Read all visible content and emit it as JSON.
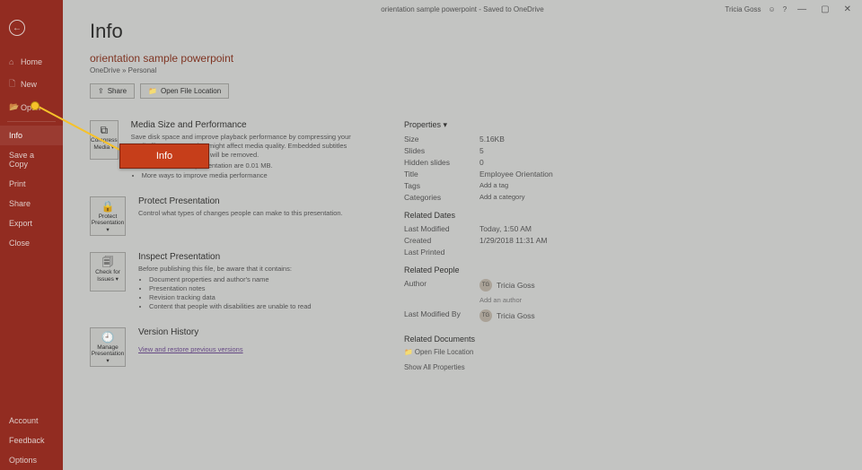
{
  "titlebar": {
    "center": "orientation sample powerpoint - Saved to OneDrive",
    "user": "Tricia Goss",
    "min": "—",
    "restore": "▢",
    "close": "✕"
  },
  "sidebar": {
    "back": "←",
    "items": [
      {
        "icon": "⌂",
        "label": "Home"
      },
      {
        "icon": "🗋",
        "label": "New"
      },
      {
        "icon": "📂",
        "label": "Open"
      },
      {
        "icon": "",
        "label": "Info"
      },
      {
        "icon": "",
        "label": "Save a Copy"
      },
      {
        "icon": "",
        "label": "Print"
      },
      {
        "icon": "",
        "label": "Share"
      },
      {
        "icon": "",
        "label": "Export"
      },
      {
        "icon": "",
        "label": "Close"
      }
    ],
    "bottom": [
      {
        "label": "Account"
      },
      {
        "label": "Feedback"
      },
      {
        "label": "Options"
      }
    ]
  },
  "page": {
    "heading": "Info",
    "doc_title": "orientation sample powerpoint",
    "doc_sub": "OneDrive » Personal",
    "share_btn": "Share",
    "openloc_btn": "Open File Location"
  },
  "sections": {
    "media": {
      "btn": "Compress Media ▾",
      "title": "Media Size and Performance",
      "desc": "Save disk space and improve playback performance by compressing your media files. Compression might affect media quality. Embedded subtitles and alternate audio tracks will be removed.",
      "bullet1": "Media files in this presentation are 0.01 MB.",
      "bullet2": "More ways to improve media performance"
    },
    "protect": {
      "btn": "Protect Presentation ▾",
      "title": "Protect Presentation",
      "desc": "Control what types of changes people can make to this presentation."
    },
    "inspect": {
      "btn": "Check for Issues ▾",
      "title": "Inspect Presentation",
      "desc": "Before publishing this file, be aware that it contains:",
      "li1": "Document properties and author's name",
      "li2": "Presentation notes",
      "li3": "Revision tracking data",
      "li4": "Content that people with disabilities are unable to read"
    },
    "version": {
      "btn": "Manage Presentation ▾",
      "title": "Version History",
      "link": "View and restore previous versions"
    }
  },
  "props": {
    "heading": "Properties ▾",
    "size_k": "Size",
    "size_v": "5.16KB",
    "slides_k": "Slides",
    "slides_v": "5",
    "hidden_k": "Hidden slides",
    "hidden_v": "0",
    "title_k": "Title",
    "title_v": "Employee Orientation",
    "tags_k": "Tags",
    "tags_v": "Add a tag",
    "cat_k": "Categories",
    "cat_v": "Add a category"
  },
  "dates": {
    "heading": "Related Dates",
    "mod_k": "Last Modified",
    "mod_v": "Today, 1:50 AM",
    "created_k": "Created",
    "created_v": "1/29/2018 11:31 AM",
    "printed_k": "Last Printed",
    "printed_v": ""
  },
  "people": {
    "heading": "Related People",
    "author_k": "Author",
    "author_initials": "TG",
    "author_name": "Tricia Goss",
    "add_author": "Add an author",
    "modby_k": "Last Modified By",
    "modby_initials": "TG",
    "modby_name": "Tricia Goss"
  },
  "docs": {
    "heading": "Related Documents",
    "open": "Open File Location",
    "all": "Show All Properties"
  },
  "callout": {
    "label": "Info"
  }
}
